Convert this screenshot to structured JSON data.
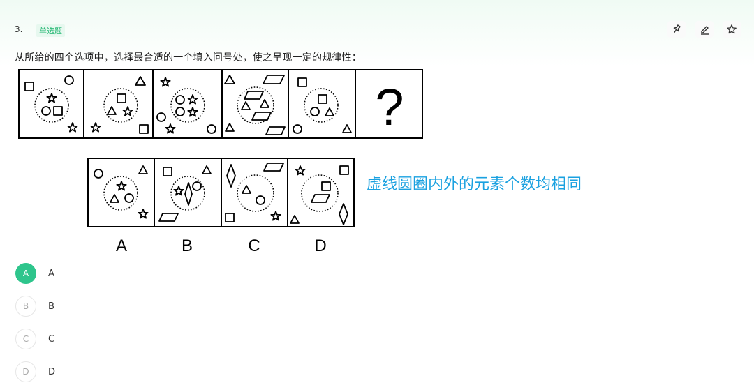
{
  "question": {
    "number": "3.",
    "type": "单选题",
    "text": "从所给的四个选项中，选择最合适的一个填入问号处，使之呈现一定的规律性：",
    "question_mark": "?",
    "annotation": "虚线圆圈内外的元素个数均相同"
  },
  "figure_labels": [
    "A",
    "B",
    "C",
    "D"
  ],
  "toolbar": {
    "icons": [
      "pin-icon",
      "edit-icon",
      "star-icon"
    ]
  },
  "options": [
    {
      "letter": "A",
      "text": "A",
      "selected": true
    },
    {
      "letter": "B",
      "text": "B",
      "selected": false
    },
    {
      "letter": "C",
      "text": "C",
      "selected": false
    },
    {
      "letter": "D",
      "text": "D",
      "selected": false
    }
  ],
  "colors": {
    "accent": "#2ec58c",
    "type_badge": "#18b36b",
    "annotation": "#1aa1e0"
  }
}
